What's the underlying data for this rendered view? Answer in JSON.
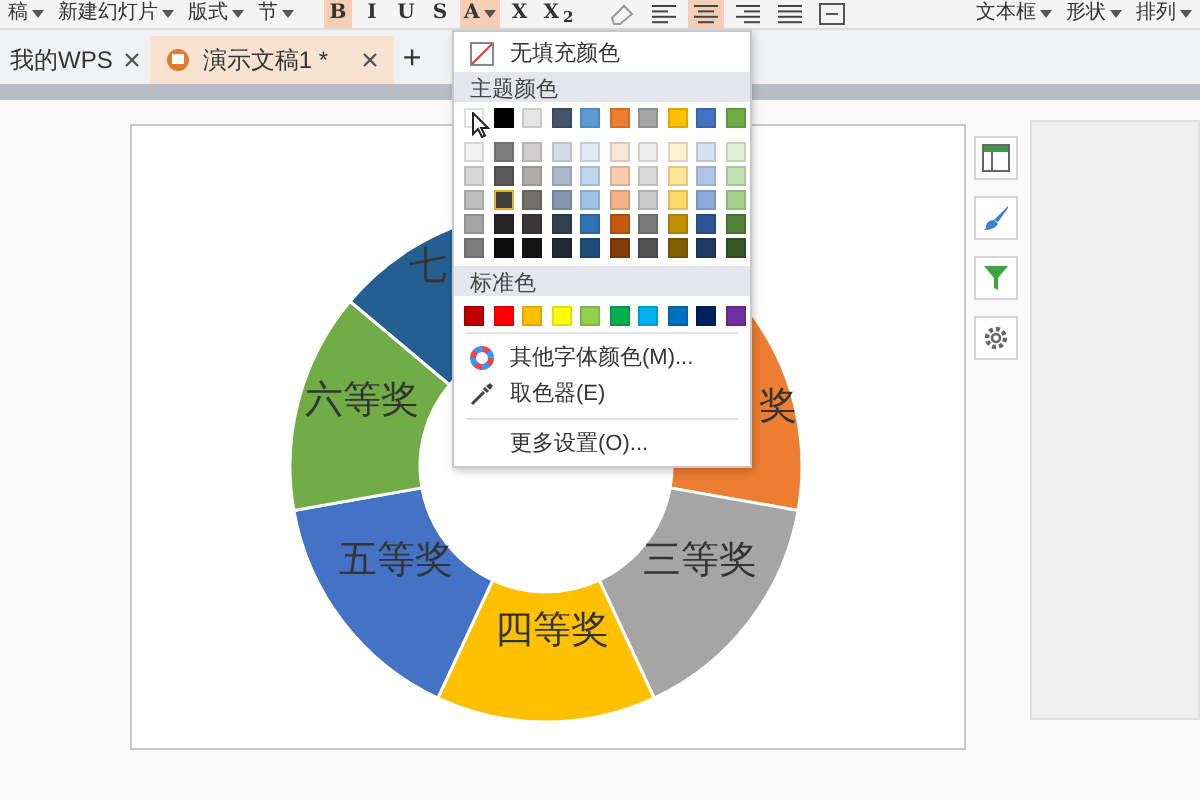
{
  "toolbar": {
    "items": [
      {
        "kind": "menu",
        "label": "稿",
        "selected": false
      },
      {
        "kind": "menu",
        "label": "新建幻灯片",
        "selected": false
      },
      {
        "kind": "menu",
        "label": "版式",
        "selected": false
      },
      {
        "kind": "menu",
        "label": "节",
        "selected": false
      },
      {
        "kind": "format",
        "label": "B",
        "selected": true
      },
      {
        "kind": "format",
        "label": "I",
        "selected": false
      },
      {
        "kind": "format",
        "label": "U",
        "selected": false
      },
      {
        "kind": "format",
        "label": "S",
        "selected": false
      },
      {
        "kind": "fontcolor",
        "label": "A",
        "selected": true
      },
      {
        "kind": "format",
        "label": "X",
        "selected": false
      },
      {
        "kind": "format",
        "label": "X$_{2}$",
        "selected": false
      },
      {
        "kind": "eraser",
        "selected": false
      },
      {
        "kind": "align-left",
        "selected": false
      },
      {
        "kind": "align-center",
        "selected": true
      },
      {
        "kind": "align-right",
        "selected": false
      },
      {
        "kind": "align-justify",
        "selected": false
      },
      {
        "kind": "textbox",
        "selected": false
      },
      {
        "kind": "menu",
        "label": "文本框",
        "selected": false
      },
      {
        "kind": "menu",
        "label": "形状",
        "selected": false
      },
      {
        "kind": "menu",
        "label": "排列",
        "selected": false
      }
    ]
  },
  "tabs": [
    {
      "label": "我的WPS",
      "selected": false
    },
    {
      "label": "演示文稿1 *",
      "selected": true
    }
  ],
  "new_tab": "+",
  "slices": [
    {
      "label": "七",
      "color": "#255e91"
    },
    {
      "label": "奖",
      "color": "#ed7d31"
    },
    {
      "label": "三等奖",
      "color": "#a5a5a5"
    },
    {
      "label": "四等奖",
      "color": "#ffc000"
    },
    {
      "label": "五等奖",
      "color": "#4472c4"
    },
    {
      "label": "六等奖",
      "color": "#70ad47"
    }
  ],
  "color_menu": {
    "no_fill": "无填充颜色",
    "theme_header": "主题颜色",
    "theme_rows": [
      [
        {
          "color": "#ffffff",
          "selected": false
        },
        {
          "color": "#000000",
          "selected": false
        },
        {
          "color": "#e7e6e6",
          "selected": false
        },
        {
          "color": "#44546a",
          "selected": false
        },
        {
          "color": "#5b9bd5",
          "selected": false
        },
        {
          "color": "#ed7d31",
          "selected": false
        },
        {
          "color": "#a5a5a5",
          "selected": false
        },
        {
          "color": "#ffc000",
          "selected": false
        },
        {
          "color": "#4472c4",
          "selected": false
        },
        {
          "color": "#70ad47",
          "selected": false
        }
      ],
      [
        {
          "color": "#f2f2f2",
          "selected": false
        },
        {
          "color": "#7f7f7f",
          "selected": false
        },
        {
          "color": "#d0cece",
          "selected": false
        },
        {
          "color": "#d6dce4",
          "selected": false
        },
        {
          "color": "#deebf6",
          "selected": false
        },
        {
          "color": "#fbe5d5",
          "selected": false
        },
        {
          "color": "#ededed",
          "selected": false
        },
        {
          "color": "#fff2cc",
          "selected": false
        },
        {
          "color": "#d9e2f3",
          "selected": false
        },
        {
          "color": "#e2efd9",
          "selected": false
        }
      ],
      [
        {
          "color": "#d8d8d8",
          "selected": false
        },
        {
          "color": "#595959",
          "selected": false
        },
        {
          "color": "#aeabab",
          "selected": false
        },
        {
          "color": "#adb9ca",
          "selected": false
        },
        {
          "color": "#bdd7ee",
          "selected": false
        },
        {
          "color": "#f7cbac",
          "selected": false
        },
        {
          "color": "#dbdbdb",
          "selected": false
        },
        {
          "color": "#fee599",
          "selected": false
        },
        {
          "color": "#b4c6e7",
          "selected": false
        },
        {
          "color": "#c5e0b3",
          "selected": false
        }
      ],
      [
        {
          "color": "#bfbfbf",
          "selected": false
        },
        {
          "color": "#3f3f3f",
          "selected": true
        },
        {
          "color": "#757070",
          "selected": false
        },
        {
          "color": "#8496b0",
          "selected": false
        },
        {
          "color": "#9cc3e5",
          "selected": false
        },
        {
          "color": "#f4b183",
          "selected": false
        },
        {
          "color": "#c9c9c9",
          "selected": false
        },
        {
          "color": "#ffd965",
          "selected": false
        },
        {
          "color": "#8eaadb",
          "selected": false
        },
        {
          "color": "#a8d08d",
          "selected": false
        }
      ],
      [
        {
          "color": "#a5a5a5",
          "selected": false
        },
        {
          "color": "#262626",
          "selected": false
        },
        {
          "color": "#3a3838",
          "selected": false
        },
        {
          "color": "#323f4f",
          "selected": false
        },
        {
          "color": "#2e75b5",
          "selected": false
        },
        {
          "color": "#c55a11",
          "selected": false
        },
        {
          "color": "#7b7b7b",
          "selected": false
        },
        {
          "color": "#bf9000",
          "selected": false
        },
        {
          "color": "#2f5496",
          "selected": false
        },
        {
          "color": "#538135",
          "selected": false
        }
      ],
      [
        {
          "color": "#7f7f7f",
          "selected": false
        },
        {
          "color": "#0c0c0c",
          "selected": false
        },
        {
          "color": "#171616",
          "selected": false
        },
        {
          "color": "#222a35",
          "selected": false
        },
        {
          "color": "#1e4e79",
          "selected": false
        },
        {
          "color": "#833c0b",
          "selected": false
        },
        {
          "color": "#525252",
          "selected": false
        },
        {
          "color": "#7f6000",
          "selected": false
        },
        {
          "color": "#1f3864",
          "selected": false
        },
        {
          "color": "#375623",
          "selected": false
        }
      ]
    ],
    "standard_header": "标准色",
    "standard_colors": [
      {
        "color": "#c00000",
        "selected": false
      },
      {
        "color": "#ff0000",
        "selected": false
      },
      {
        "color": "#ffc000",
        "selected": false
      },
      {
        "color": "#ffff00",
        "selected": false
      },
      {
        "color": "#92d050",
        "selected": false
      },
      {
        "color": "#00b050",
        "selected": false
      },
      {
        "color": "#00b0f0",
        "selected": false
      },
      {
        "color": "#0070c0",
        "selected": false
      },
      {
        "color": "#002060",
        "selected": false
      },
      {
        "color": "#7030a0",
        "selected": false
      }
    ],
    "more_colors": "其他字体颜色(M)...",
    "eyedropper": "取色器(E)",
    "more_settings": "更多设置(O)..."
  }
}
